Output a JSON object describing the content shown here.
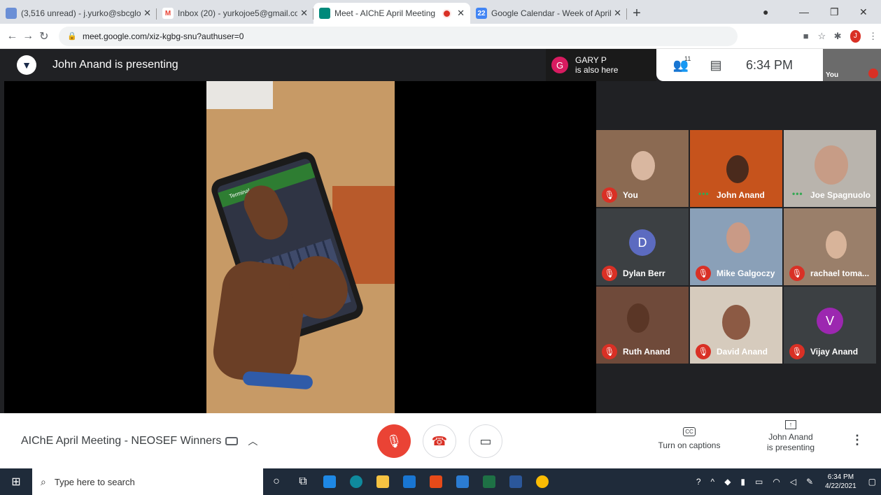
{
  "browser": {
    "tabs": [
      {
        "title": "(3,516 unread) - j.yurko@sbcglob",
        "favicon_color": "#6b8fd6"
      },
      {
        "title": "Inbox (20) - yurkojoe5@gmail.co",
        "favicon_color": "#ea4335"
      },
      {
        "title": "Meet - AIChE April Meeting",
        "favicon_color": "#00897b",
        "recording": true
      },
      {
        "title": "Google Calendar - Week of April",
        "favicon_color": "#4285f4",
        "favicon_text": "22"
      }
    ],
    "new_tab": "+",
    "url": "meet.google.com/xiz-kgbg-snu?authuser=0",
    "profile_initial": "J"
  },
  "meet": {
    "presenting_banner": "John Anand is presenting",
    "also_here": {
      "initial": "G",
      "name": "GARY P",
      "status": "is also here"
    },
    "participant_count": "11",
    "time": "6:34 PM",
    "self_label": "You",
    "tiles": [
      {
        "name": "You",
        "muted": true,
        "bg": "#8b6a52"
      },
      {
        "name": "John Anand",
        "muted": false,
        "bg": "#c6531c"
      },
      {
        "name": "Joe Spagnuolo",
        "muted": false,
        "bg": "#b9b4ad"
      },
      {
        "name": "Dylan Berr",
        "muted": true,
        "bg": "#3c4043",
        "initial": "D",
        "avatar_color": "#5c6bc0"
      },
      {
        "name": "Mike Galgoczy",
        "muted": true,
        "bg": "#8aa0b8"
      },
      {
        "name": "rachael toma...",
        "muted": true,
        "bg": "#9a7f6a"
      },
      {
        "name": "Ruth Anand",
        "muted": true,
        "bg": "#6f4a3a"
      },
      {
        "name": "David Anand",
        "muted": true,
        "bg": "#d6cbbd"
      },
      {
        "name": "Vijay Anand",
        "muted": true,
        "bg": "#3c4043",
        "initial": "V",
        "avatar_color": "#9c27b0"
      }
    ],
    "meeting_name": "AIChE April Meeting - NEOSEF Winners",
    "captions_label": "Turn on captions",
    "captions_icon": "CC",
    "presenting_label_1": "John Anand",
    "presenting_label_2": "is presenting",
    "phone_app_title": "Terminal"
  },
  "taskbar": {
    "search_placeholder": "Type here to search",
    "clock_time": "6:34 PM",
    "clock_date": "4/22/2021"
  }
}
